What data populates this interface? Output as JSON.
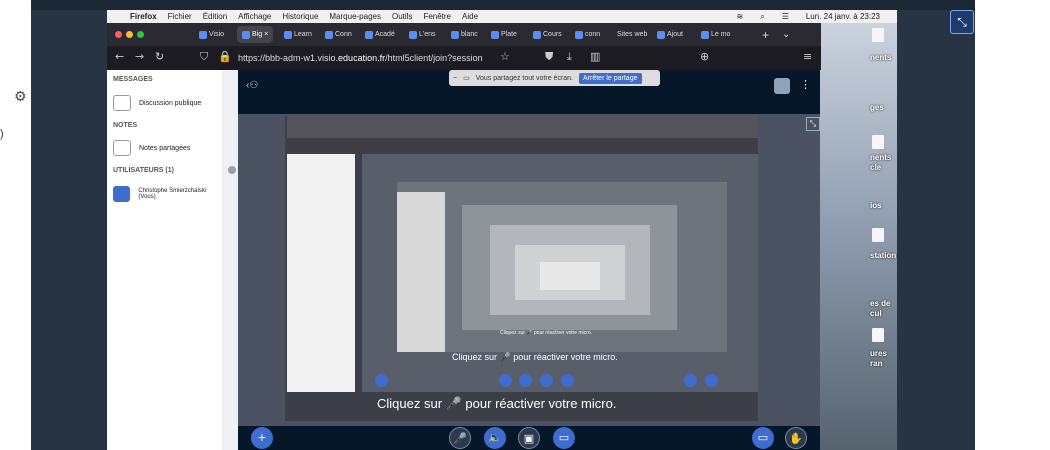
{
  "outer": {
    "fullscreen_icon": "fullscreen-exit-icon",
    "gear_icon": "gear-icon"
  },
  "menubar": {
    "apple": "",
    "app": "Firefox",
    "items": [
      "Fichier",
      "Édition",
      "Affichage",
      "Historique",
      "Marque-pages",
      "Outils",
      "Fenêtre",
      "Aide"
    ],
    "datetime": "Lun. 24 janv. à 23:23"
  },
  "browser": {
    "tabs": [
      "Visio",
      "Big",
      "Learn",
      "Conn",
      "Acadé",
      "L'ens",
      "blanc",
      "Plate",
      "Cours",
      "conn",
      "Sites web",
      "Ajout",
      "Le mo"
    ],
    "active_tab": "Big",
    "url_prefix": "https://bbb-adm-w1.visio.",
    "url_domain": "education.fr",
    "url_suffix": "/html5client/join?session"
  },
  "sidebar": {
    "messages_title": "MESSAGES",
    "public_chat": "Discussion publique",
    "notes_title": "NOTES",
    "shared_notes": "Notes partagées",
    "users_title": "UTILISATEURS (1)",
    "user_name": "Christophe Smierzchalski (Vous)"
  },
  "screenshare": {
    "message": "Vous partagez tout votre écran.",
    "stop_button": "Arrêter le partage"
  },
  "mic_notice": "Cliquez sur 🎤 pour réactiver votre micro.",
  "desktop_labels": [
    "nents",
    "ges",
    "nents",
    "cle",
    "ios",
    "station",
    "es de",
    "cul",
    "ures",
    "ran"
  ]
}
